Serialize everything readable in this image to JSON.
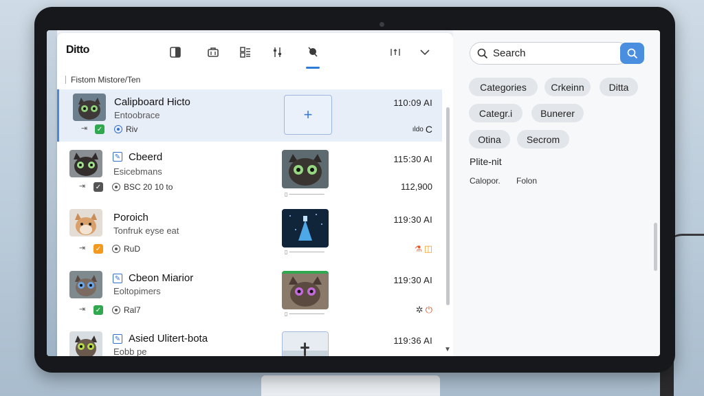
{
  "app": {
    "title": "Ditto"
  },
  "toolbar": {
    "icons": [
      "panel-icon",
      "briefcase-icon",
      "grid-list-icon",
      "sliders-icon",
      "pin-icon",
      "sort-icon",
      "chevron-down-icon"
    ]
  },
  "breadcrumb": "Fistom Mistore/Ten",
  "items": [
    {
      "title": "Calipboard Hicto",
      "subtitle": "Entoobrace",
      "meta": "Riv",
      "time": "110:09 AI",
      "right": "C",
      "right_prefix": "ıldo"
    },
    {
      "title": "Cbeerd",
      "subtitle": "Esicebmans",
      "meta": "BSC 20 10 to",
      "time": "115:30 AI",
      "right": "112,900"
    },
    {
      "title": "Poroich",
      "subtitle": "Tonfruk eyse eat",
      "meta": "RuD",
      "time": "119:30 AI",
      "right": ""
    },
    {
      "title": "Cbeon Miarior",
      "subtitle": "Eoltopimers",
      "meta": "Ral7",
      "time": "119:30 AI",
      "right": ""
    },
    {
      "title": "Asied Ulitert-bota",
      "subtitle": "Eobb pe",
      "meta": "",
      "time": "119:36 AI",
      "right": ""
    }
  ],
  "search": {
    "placeholder": "Search"
  },
  "chips": [
    "Categories",
    "Crkeinn",
    "Ditta",
    "Categr.i",
    "Bunerer",
    "Otina",
    "Secrom"
  ],
  "right_panel": {
    "label": "Plite-nit",
    "small_left": "Calopor.",
    "small_right": "Folon"
  },
  "colors": {
    "accent": "#4a8ee0",
    "selected_row": "#e8eef8",
    "check_green": "#2fa84f",
    "check_orange": "#f39a1e"
  }
}
